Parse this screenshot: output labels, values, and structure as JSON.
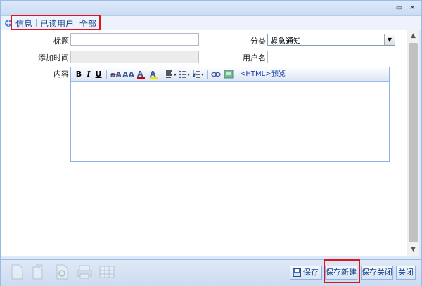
{
  "window": {
    "controls": [
      "restore-icon",
      "close-icon"
    ]
  },
  "tabs": [
    {
      "label": "信息"
    },
    {
      "label": "已读用户"
    },
    {
      "label": "全部"
    }
  ],
  "form": {
    "title_label": "标题",
    "title_value": "",
    "category_label": "分类",
    "category_value": "紧急通知",
    "added_time_label": "添加时间",
    "added_time_value": "",
    "username_label": "用户名",
    "username_value": "",
    "content_label": "内容"
  },
  "editor": {
    "bold": "B",
    "italic": "I",
    "underline": "U",
    "html_link": "<HTML>",
    "preview_link": "预览"
  },
  "footer": {
    "save": "保存",
    "save_new": "保存新建",
    "save_close": "保存关闭",
    "close": "关闭"
  },
  "colors": {
    "highlight": "#e4121b",
    "link": "#15428b"
  }
}
